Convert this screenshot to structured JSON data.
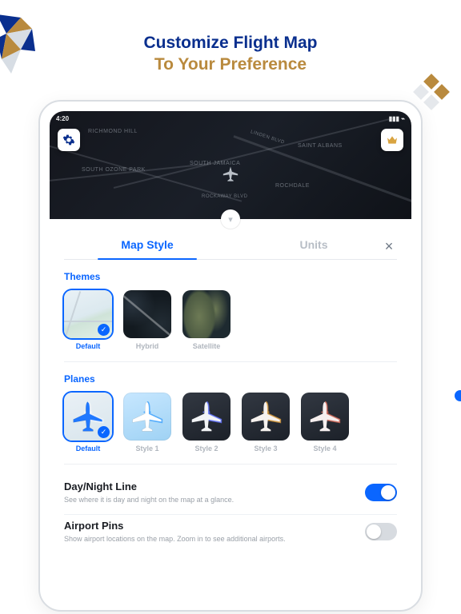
{
  "promo": {
    "line1": "Customize Flight Map",
    "line2": "To Your Preference",
    "color_line1": "#0a2f8e",
    "color_line2": "#b98a3e"
  },
  "status": {
    "time": "4:20"
  },
  "map": {
    "places": [
      "RICHMOND HILL",
      "SOUTH OZONE PARK",
      "SOUTH JAMAICA",
      "SAINT ALBANS",
      "ROCHDALE",
      "Rockaway Blvd",
      "Linden Blvd"
    ],
    "poi_left_icon": "gear-icon",
    "poi_right_icon": "crown-icon"
  },
  "tabs": {
    "active": "Map Style",
    "items": [
      "Map Style",
      "Units"
    ],
    "close": "×"
  },
  "themes": {
    "heading": "Themes",
    "items": [
      {
        "label": "Default",
        "selected": true
      },
      {
        "label": "Hybrid",
        "selected": false
      },
      {
        "label": "Satellite",
        "selected": false
      }
    ]
  },
  "planes": {
    "heading": "Planes",
    "items": [
      {
        "label": "Default",
        "selected": true,
        "body": "#1f78ff",
        "accent": "#ffffff"
      },
      {
        "label": "Style 1",
        "selected": false,
        "body": "#ffffff",
        "accent": "#3da2ff"
      },
      {
        "label": "Style 2",
        "selected": false,
        "body": "#f2f4f6",
        "accent": "#6072ff"
      },
      {
        "label": "Style 3",
        "selected": false,
        "body": "#f6f2ef",
        "accent": "#d89a3a"
      },
      {
        "label": "Style 4",
        "selected": false,
        "body": "#f6efef",
        "accent": "#d46a5a"
      }
    ]
  },
  "toggles": [
    {
      "title": "Day/Night Line",
      "desc": "See where it is day and night on the map at a glance.",
      "on": true
    },
    {
      "title": "Airport Pins",
      "desc": "Show airport locations on the map. Zoom in to see additional airports.",
      "on": false
    }
  ]
}
